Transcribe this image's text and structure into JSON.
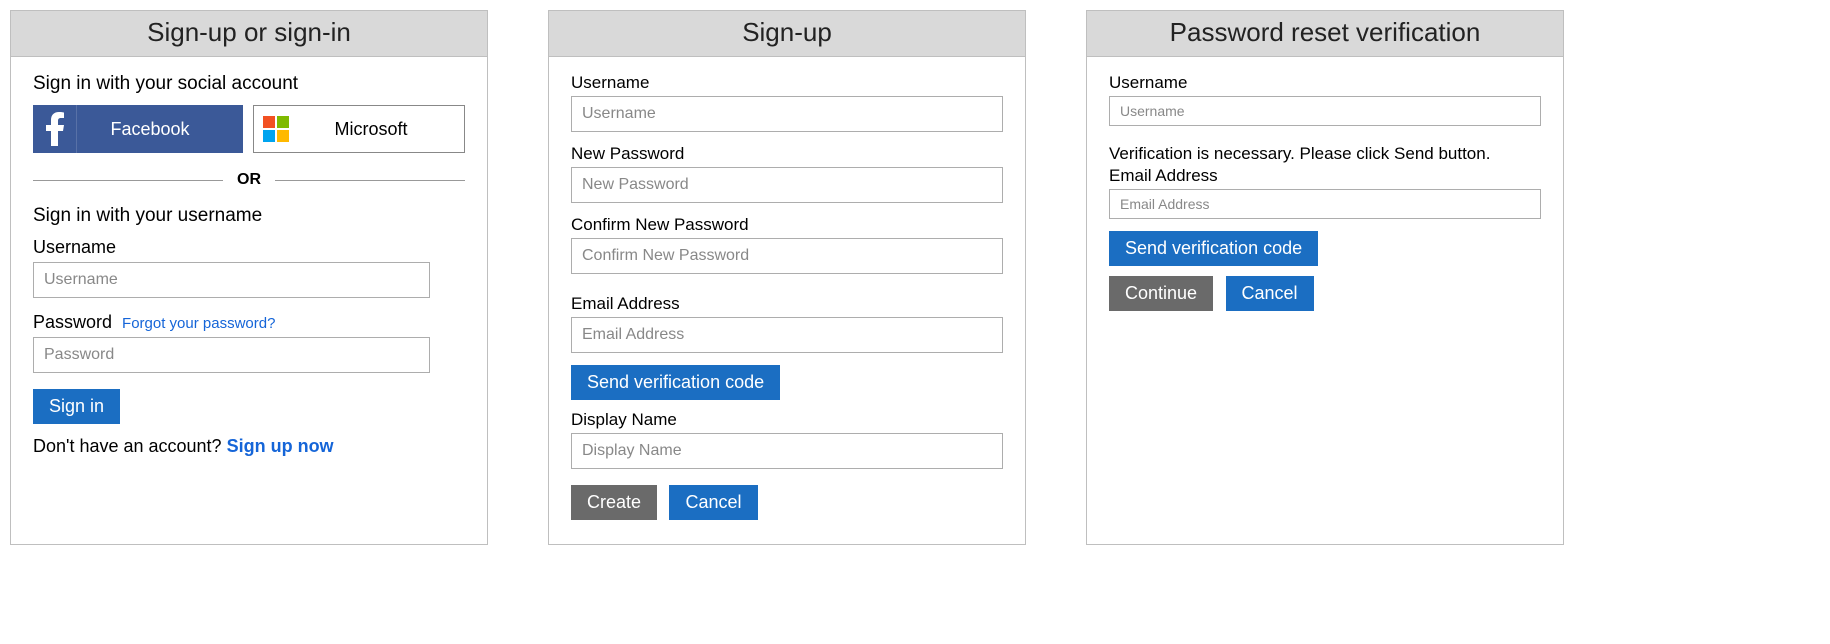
{
  "signin": {
    "header": "Sign-up or sign-in",
    "social_heading": "Sign in with your social account",
    "facebook_label": "Facebook",
    "microsoft_label": "Microsoft",
    "divider": "OR",
    "username_heading": "Sign in with your username",
    "username_label": "Username",
    "username_placeholder": "Username",
    "password_label": "Password",
    "forgot_link": "Forgot your password?",
    "password_placeholder": "Password",
    "signin_button": "Sign in",
    "no_account_text": "Don't have an account? ",
    "signup_link": "Sign up now"
  },
  "signup": {
    "header": "Sign-up",
    "username_label": "Username",
    "username_placeholder": "Username",
    "newpass_label": "New Password",
    "newpass_placeholder": "New Password",
    "confirm_label": "Confirm New Password",
    "confirm_placeholder": "Confirm New Password",
    "email_label": "Email Address",
    "email_placeholder": "Email Address",
    "send_code_button": "Send verification code",
    "display_label": "Display Name",
    "display_placeholder": "Display Name",
    "create_button": "Create",
    "cancel_button": "Cancel"
  },
  "reset": {
    "header": "Password reset verification",
    "username_label": "Username",
    "username_placeholder": "Username",
    "info_text": "Verification is necessary. Please click Send button.",
    "email_label": "Email Address",
    "email_placeholder": "Email Address",
    "send_code_button": "Send verification code",
    "continue_button": "Continue",
    "cancel_button": "Cancel"
  }
}
